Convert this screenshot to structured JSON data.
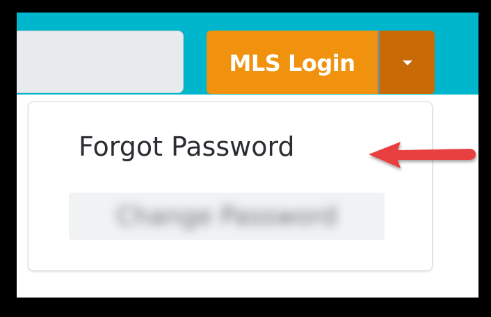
{
  "header": {
    "search": {
      "value": "",
      "placeholder": ""
    },
    "login_button": {
      "label": "MLS Login"
    },
    "dropdown_toggle": {
      "icon": "caret-down-icon"
    }
  },
  "dropdown_menu": {
    "items": [
      {
        "label": "Forgot Password",
        "highlighted_by_arrow": true
      },
      {
        "label": "Change Password",
        "blurred": true
      }
    ]
  },
  "annotation": {
    "icon": "red-arrow-icon",
    "color": "#e8413f"
  },
  "colors": {
    "header_background": "#00b6cc",
    "login_button": "#f0920e",
    "dropdown_toggle": "#c86b06",
    "frame_border": "#000000"
  }
}
